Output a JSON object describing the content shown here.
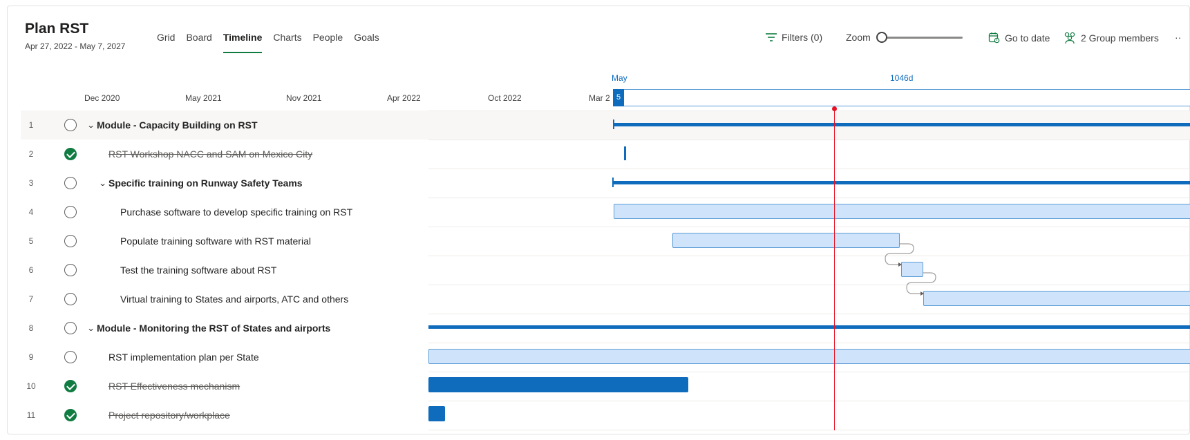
{
  "plan": {
    "title": "Plan RST",
    "dates": "Apr 27, 2022 - May 7, 2027"
  },
  "tabs": [
    {
      "label": "Grid"
    },
    {
      "label": "Board"
    },
    {
      "label": "Timeline"
    },
    {
      "label": "Charts"
    },
    {
      "label": "People"
    },
    {
      "label": "Goals"
    }
  ],
  "active_tab": "Timeline",
  "toolbar": {
    "filters_label": "Filters (0)",
    "zoom_label": "Zoom",
    "goto_label": "Go to date",
    "members_label": "2 Group members",
    "more_label": "··"
  },
  "timeline": {
    "ticks": [
      "Dec 2020",
      "May 2021",
      "Nov 2021",
      "Apr 2022",
      "Oct 2022",
      "Mar 2"
    ],
    "range_month": "May",
    "range_day": "5",
    "range_duration": "1046d"
  },
  "tasks": [
    {
      "num": "1",
      "name": "Module - Capacity Building on RST",
      "done": false,
      "summary": true
    },
    {
      "num": "2",
      "name": "RST Workshop NACC and SAM on Mexico City",
      "done": true,
      "summary": false
    },
    {
      "num": "3",
      "name": "Specific training on Runway Safety Teams",
      "done": false,
      "summary": true
    },
    {
      "num": "4",
      "name": "Purchase software to develop specific training on RST",
      "done": false,
      "summary": false
    },
    {
      "num": "5",
      "name": "Populate training software with RST material",
      "done": false,
      "summary": false
    },
    {
      "num": "6",
      "name": "Test the training software about RST",
      "done": false,
      "summary": false
    },
    {
      "num": "7",
      "name": "Virtual training to States and airports, ATC and others",
      "done": false,
      "summary": false
    },
    {
      "num": "8",
      "name": "Module - Monitoring the RST of States and airports",
      "done": false,
      "summary": true
    },
    {
      "num": "9",
      "name": "RST implementation plan per State",
      "done": false,
      "summary": false
    },
    {
      "num": "10",
      "name": "RST Effectiveness mechanism",
      "done": true,
      "summary": false
    },
    {
      "num": "11",
      "name": "Project repository/workplace",
      "done": true,
      "summary": false
    }
  ],
  "colors": {
    "accent": "#0f6cbd",
    "bar_fill": "#cfe4fa",
    "done_green": "#107c41",
    "today_line": "#e81123",
    "active_tab_underline": "#107c41"
  }
}
